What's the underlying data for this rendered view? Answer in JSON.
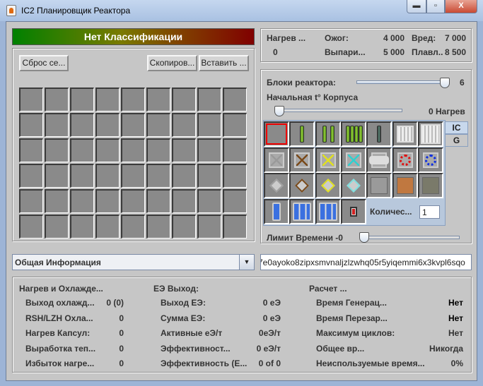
{
  "window": {
    "title": "IC2 Планировщик Реактора",
    "minimize": "▬",
    "maximize": "▫",
    "close": "X"
  },
  "classification": "Нет Классификации",
  "toolbar": {
    "reset": "Сброс се...",
    "copy": "Скопиров...",
    "paste": "Вставить ..."
  },
  "grid": {
    "columns": 9,
    "rows": 6
  },
  "heat_info": {
    "heat_label": "Нагрев ...",
    "heat_value": "0",
    "burn_label": "Ожог:",
    "burn_value": "4 000",
    "harm_label": "Вред:",
    "harm_value": "7 000",
    "evap_label": "Выпари...",
    "evap_value": "5 000",
    "melt_label": "Плавл..",
    "melt_value": "8 500"
  },
  "settings": {
    "blocks_label": "Блоки реактора:",
    "blocks_value": "6",
    "blocks_level": 6,
    "blocks_max": 6,
    "hull_label": "Начальная t° Корпуса",
    "hull_value": "0 Нагрев",
    "hull_level": 0
  },
  "palette": {
    "tabs": [
      {
        "label": "IC",
        "active": true
      },
      {
        "label": "G",
        "active": false
      }
    ],
    "items": [
      {
        "icon": "empty",
        "selected": true
      },
      {
        "icon": "rod-1"
      },
      {
        "icon": "rod-2"
      },
      {
        "icon": "rod-4"
      },
      {
        "icon": "rod-depleted"
      },
      {
        "icon": "grate"
      },
      {
        "icon": "grate-large"
      },
      {
        "icon": "vent",
        "color": "#9a9a9a"
      },
      {
        "icon": "vent",
        "color": "#7a4a1a"
      },
      {
        "icon": "vent",
        "color": "#e0e020"
      },
      {
        "icon": "vent",
        "color": "#30d0d0"
      },
      {
        "icon": "exchanger-big",
        "color": "#a0a0a0"
      },
      {
        "icon": "ring",
        "color": "#e01010"
      },
      {
        "icon": "ring",
        "color": "#1030e0"
      },
      {
        "icon": "exchanger",
        "color": "#a0a0a0"
      },
      {
        "icon": "exchanger",
        "color": "#7a4a1a"
      },
      {
        "icon": "exchanger",
        "color": "#e0e020"
      },
      {
        "icon": "exchanger",
        "color": "#80e0e0"
      },
      {
        "icon": "plating",
        "color": "#9a9a9a"
      },
      {
        "icon": "plating",
        "color": "#c07840"
      },
      {
        "icon": "plating",
        "color": "#7a7a6a"
      },
      {
        "icon": "coolant-1"
      },
      {
        "icon": "coolant-3"
      },
      {
        "icon": "coolant-6"
      },
      {
        "icon": "condensator"
      }
    ],
    "quantity_label": "Количес...",
    "quantity_value": "1"
  },
  "time_limit": {
    "label": "Лимит Времени -0",
    "level": 0
  },
  "view_select": {
    "value": "Общая Информация"
  },
  "code_field": {
    "value": "7e0ayoko8zipxsmvnaljzlzwhq05r5yiqemmi6x3kvpl6sqo"
  },
  "stats": {
    "heat": {
      "title": "Нагрев и Охлажде...",
      "rows": [
        {
          "label": "Выход охлажд...",
          "value": "0 (0)"
        },
        {
          "label": "RSH/LZH Охла...",
          "value": "0"
        },
        {
          "label": "Нагрев Капсул:",
          "value": "0"
        },
        {
          "label": "Выработка теп...",
          "value": "0"
        },
        {
          "label": "Избыток нагре...",
          "value": "0"
        }
      ]
    },
    "eu": {
      "title": "ЕЭ Выход:",
      "rows": [
        {
          "label": "Выход ЕЭ:",
          "value": "0 еЭ"
        },
        {
          "label": "Сумма ЕЭ:",
          "value": "0 еЭ"
        },
        {
          "label": "Активные еЭ/т",
          "value": "0еЭ/т"
        },
        {
          "label": "Эффективност...",
          "value": "0 еЭ/т"
        },
        {
          "label": "Эффективность (Е...",
          "value": "0 of 0"
        }
      ]
    },
    "calc": {
      "title": "Расчет ...",
      "rows": [
        {
          "label": "Время Генерац...",
          "value": "Нет",
          "strong": true
        },
        {
          "label": "Время Перезар...",
          "value": "Нет",
          "strong": true
        },
        {
          "label": "Максимум циклов:",
          "value": "Нет"
        },
        {
          "label": "Общее вр...",
          "value": "Никогда"
        },
        {
          "label": "Неиспользуемые время...",
          "value": "0%"
        }
      ]
    }
  }
}
